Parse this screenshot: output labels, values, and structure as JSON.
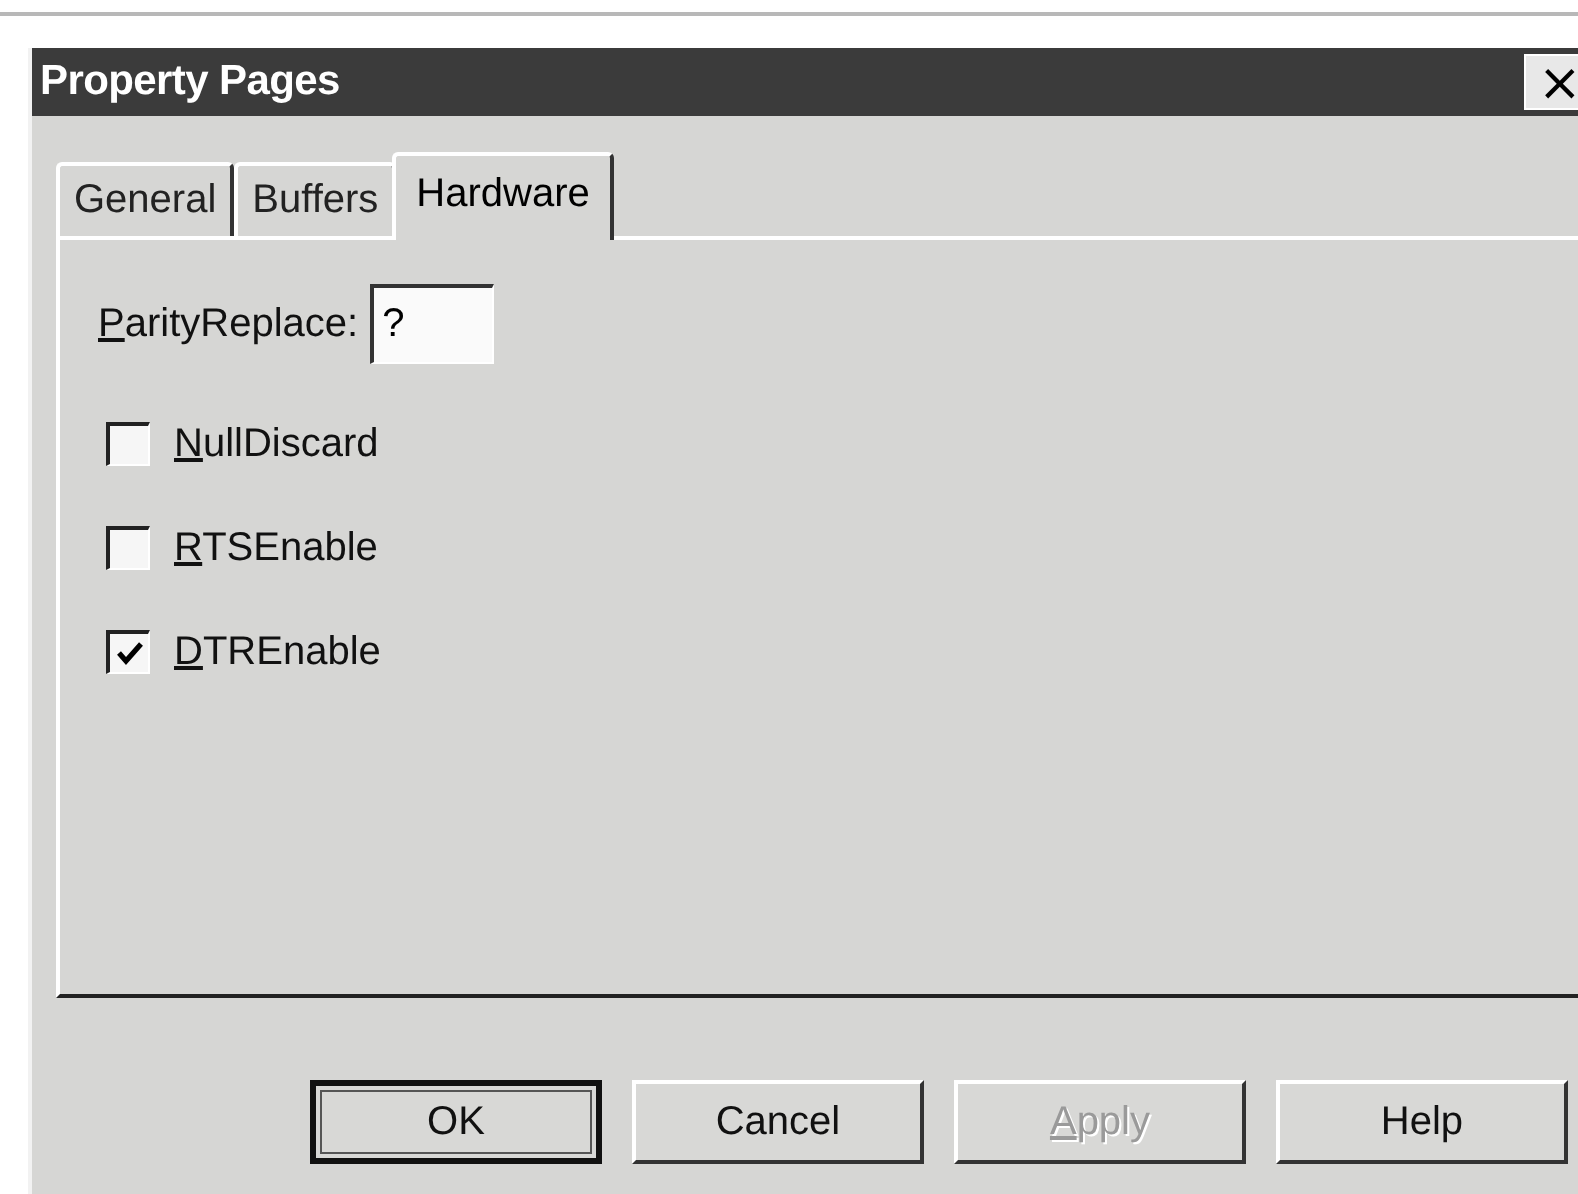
{
  "window": {
    "title": "Property Pages",
    "close": "×"
  },
  "tabs": [
    {
      "label": "General",
      "selected": false
    },
    {
      "label": "Buffers",
      "selected": false
    },
    {
      "label": "Hardware",
      "selected": true
    }
  ],
  "parity_replace": {
    "label": "ParityReplace:",
    "mnemonic": true,
    "value": "?"
  },
  "checkboxes": [
    {
      "label": "NullDiscard",
      "mnemonic": true,
      "checked": false
    },
    {
      "label": "RTSEnable",
      "mnemonic": true,
      "checked": false
    },
    {
      "label": "DTREnable",
      "mnemonic": true,
      "checked": true
    }
  ],
  "buttons": [
    {
      "label": "OK",
      "default": true,
      "disabled": false,
      "mnemonic": false
    },
    {
      "label": "Cancel",
      "default": false,
      "disabled": false,
      "mnemonic": false
    },
    {
      "label": "Apply",
      "default": false,
      "disabled": true,
      "mnemonic": true
    },
    {
      "label": "Help",
      "default": false,
      "disabled": false,
      "mnemonic": false
    }
  ]
}
